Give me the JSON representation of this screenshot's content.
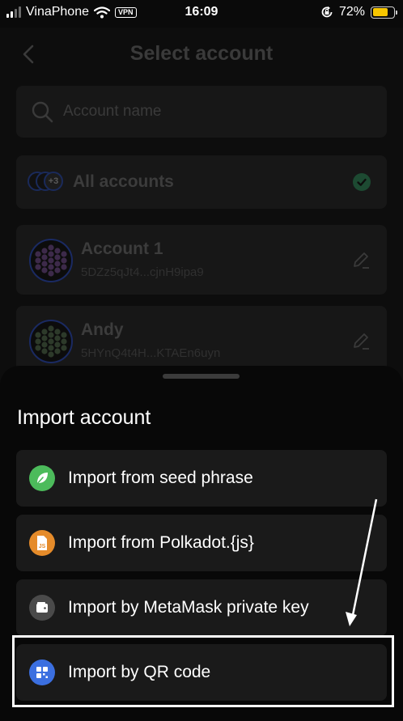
{
  "status_bar": {
    "carrier": "VinaPhone",
    "vpn_badge": "VPN",
    "time": "16:09",
    "battery_percent": "72%",
    "battery_level": 0.72,
    "battery_color": "#f7c600"
  },
  "header": {
    "title": "Select account",
    "back_icon": "chevron-left-icon"
  },
  "search": {
    "placeholder": "Account name",
    "value": ""
  },
  "all_accounts": {
    "label": "All accounts",
    "count_badge": "+3",
    "selected": true,
    "check_color": "#1d4a32"
  },
  "accounts": [
    {
      "name": "Account 1",
      "address": "5DZz5qJt4...cjnH9ipa9"
    },
    {
      "name": "Andy",
      "address": "5HYnQ4t4H...KTAEn6uyn"
    }
  ],
  "import_sheet": {
    "title": "Import account",
    "options": [
      {
        "label": "Import from seed phrase",
        "icon": "leaf-icon",
        "color": "#4cbb5b"
      },
      {
        "label": "Import from Polkadot.{js}",
        "icon": "js-file-icon",
        "color": "#e58b2a"
      },
      {
        "label": "Import by MetaMask private key",
        "icon": "wallet-icon",
        "color": "#4a4a4a"
      },
      {
        "label": "Import by QR code",
        "icon": "qr-code-icon",
        "color": "#3b6fe0"
      }
    ]
  }
}
